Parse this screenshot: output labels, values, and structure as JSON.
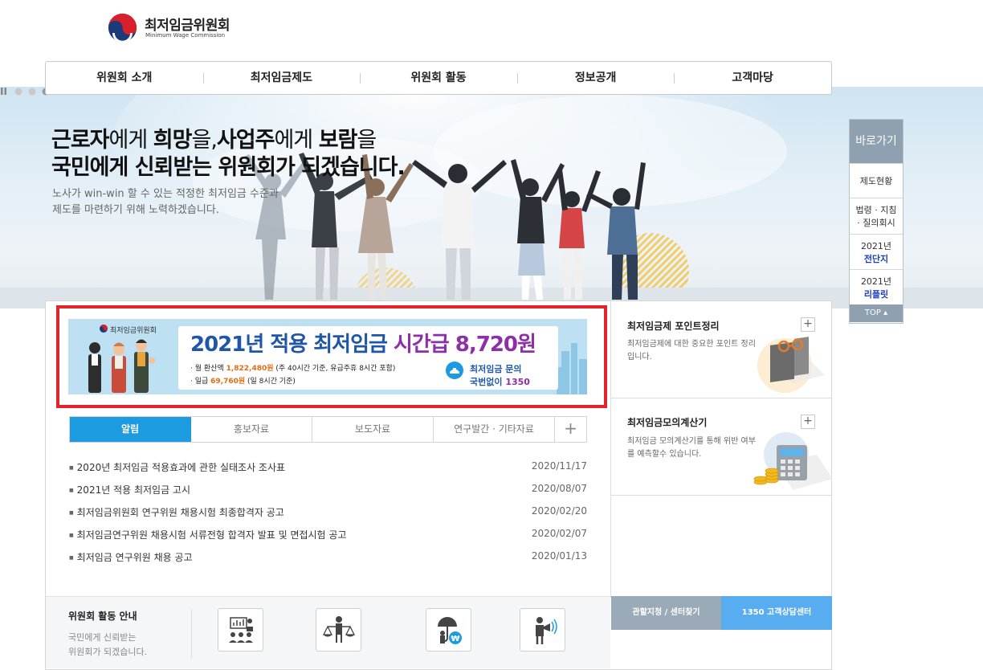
{
  "header": {
    "logo_kr": "최저임금위원회",
    "logo_en": "Minimum Wage Commission"
  },
  "nav": [
    "위원회 소개",
    "최저임금제도",
    "위원회 활동",
    "정보공개",
    "고객마당"
  ],
  "hero": {
    "line1": [
      {
        "t": "근로자",
        "b": true
      },
      {
        "t": "에게 ",
        "b": false
      },
      {
        "t": "희망",
        "b": true
      },
      {
        "t": "을,",
        "b": false
      },
      {
        "t": "사업주",
        "b": true
      },
      {
        "t": "에게 ",
        "b": false
      },
      {
        "t": "보람",
        "b": true
      },
      {
        "t": "을",
        "b": false
      }
    ],
    "line2": "국민에게 신뢰받는 위원회가 되겠습니다.",
    "sub1": "노사가 win-win 할 수 있는 적정한 최저임금 수준과",
    "sub2": "제도를 마련하기 위해 노력하겠습니다.",
    "slides": 3,
    "active_slide": 3
  },
  "banner": {
    "logo": "최저임금위원회",
    "title_a": "2021년 적용 최저임금 ",
    "title_b": "시간급 8,720원",
    "l1_a": "· 월 환산액 ",
    "l1_b": "1,822,480원",
    "l1_c": " (주 40시간 기준, 유급주휴 8시간 포함)",
    "l2_a": "· 일급 ",
    "l2_b": "69,760원",
    "l2_c": " (일 8시간 기준)",
    "inq1": "최저임금 문의",
    "inq2_a": "국번없이 ",
    "inq2_b": "1350"
  },
  "tabs": [
    "알림",
    "홍보자료",
    "보도자료",
    "연구발간 · 기타자료"
  ],
  "tabs_plus": "+",
  "notices": [
    {
      "title": "2020년 최저임금 적용효과에 관한 실태조사 조사표",
      "date": "2020/11/17"
    },
    {
      "title": "2021년 적용 최저임금 고시",
      "date": "2020/08/07"
    },
    {
      "title": "최저임금위원회 연구위원 채용시험 최종합격자 공고",
      "date": "2020/02/20"
    },
    {
      "title": "최저임금연구위원 채용시험 서류전형 합격자 발표 및 면접시험 공고",
      "date": "2020/02/07"
    },
    {
      "title": "최저임금 연구위원 채용 공고",
      "date": "2020/01/13"
    }
  ],
  "side1": {
    "title": "최저임금제 포인트정리",
    "desc": "최저임금제에 대한 중요한 포인트 정리입니다.",
    "plus": "+"
  },
  "side2": {
    "title": "최저임금모의계산기",
    "desc": "최저임금 모의계산기를 통해 위반 여부를 예측할수 있습니다.",
    "plus": "+"
  },
  "bottom": {
    "title": "위원회 활동 안내",
    "desc1": "국민에게 신뢰받는",
    "desc2": "위원회가 되겠습니다."
  },
  "btn_center": "관할지청 / 센터찾기",
  "btn_call": "1350 고객상담센터",
  "quick": {
    "title": "바로가기",
    "item1": "제도현황",
    "item2a": "법령 · 지침",
    "item2b": "· 질의회시",
    "item3a": "2021년",
    "item3b": "전단지",
    "item4a": "2021년",
    "item4b": "리플릿",
    "top": "TOP"
  },
  "colors": {
    "accent_blue": "#1d9be0",
    "red_frame": "#e1232b",
    "title_blue": "#1f56a8",
    "title_purple": "#8c2fa8"
  }
}
